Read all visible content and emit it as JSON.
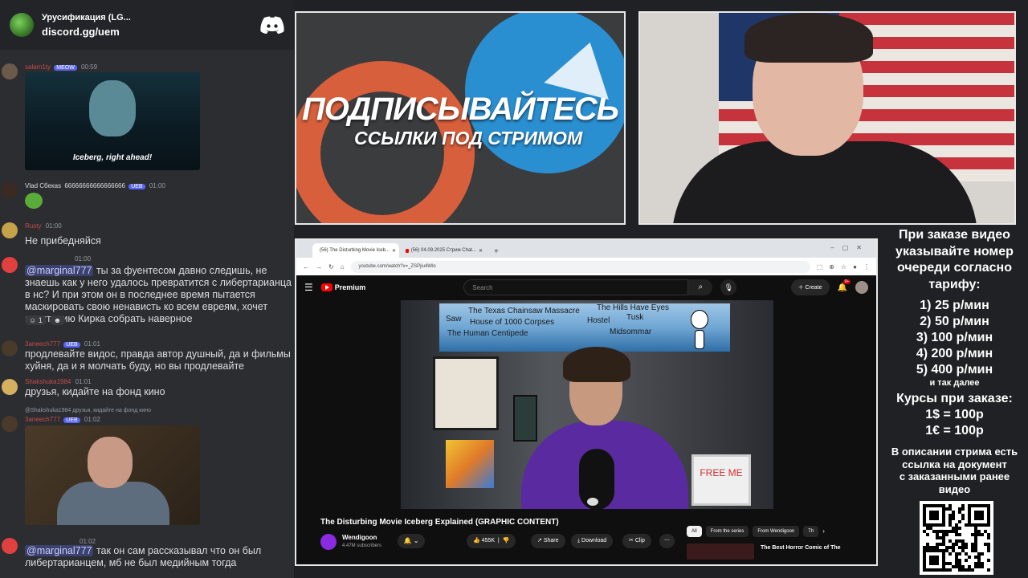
{
  "discord": {
    "server_name": "Урусификация (LG...",
    "invite": "discord.gg/uem",
    "messages": [
      {
        "user": "salam1ty",
        "badge": "MEOW",
        "time": "00:59",
        "gif_caption": "Iceberg, right ahead!"
      },
      {
        "user": "Vlad Сбекаs",
        "text_inline": "66666666666666666",
        "badge": "UEB",
        "time": "01:00"
      },
      {
        "user": "Rusty",
        "time": "01:00",
        "text": "Не прибедняйся"
      },
      {
        "text_mention": "@marginal777",
        "text": " ты за фуентесом давно следишь, не знаешь как у него удалось превратится с либертарианца в нс? И при этом он в последнее время пытается маскировать свою ненависть ко всем евреям, хочет аудиторию Кирка собрать наверное",
        "time": "01:00",
        "reaction_count": "1"
      },
      {
        "user": "3aneech777",
        "badge": "UEB",
        "time": "01:01",
        "text": "продлевайте видос, правда автор душный, да и фильмы хуйня, да и я молчать буду, но вы продлевайте"
      },
      {
        "user": "Shakshuka1984",
        "time": "01:01",
        "text": "друзья, кидайте на фонд кино"
      },
      {
        "reply_to": "@Shakshuka1984 друзья, кидайте на фонд кино",
        "user": "3aneech777",
        "badge": "UEB",
        "time": "01:02"
      },
      {
        "text_mention": "@marginal777",
        "text": " так он сам рассказывал что он был либертарианцем, мб не был медийным тогда",
        "time": "01:02"
      }
    ]
  },
  "promo": {
    "title": "ПОДПИСЫВАЙТЕСЬ",
    "subtitle": "ССЫЛКИ ПОД СТРИМОМ"
  },
  "browser": {
    "tabs": [
      {
        "label": "(56) The Disturbing Movie Iceb..."
      },
      {
        "label": "(56) 04.09.2025 Стрим Chat..."
      }
    ],
    "url": "youtube.com/watch?v=_ZSPjiu4Wlo"
  },
  "youtube": {
    "logo": "Premium",
    "search_placeholder": "Search",
    "create_label": "Create",
    "notification_count": "9+",
    "iceberg_labels": {
      "saw": "Saw",
      "tcm": "The Texas Chainsaw Massacre",
      "hills": "The Hills Have Eyes",
      "tusk": "Tusk",
      "house": "House of 1000 Corpses",
      "hostel": "Hostel",
      "centipede": "The Human Centipede",
      "midsommar": "Midsommar"
    },
    "free_me": "FREE ME",
    "video_title": "The Disturbing Movie Iceberg Explained (GRAPHIC CONTENT)",
    "channel_name": "Wendigoon",
    "subscribers": "4.47M subscribers",
    "likes": "455K",
    "share_label": "Share",
    "download_label": "Download",
    "clip_label": "Clip",
    "chips": [
      "All",
      "From the series",
      "From Wendigoon",
      "Th"
    ],
    "rec_title": "The Best Horror Comic of The"
  },
  "info": {
    "order_text": [
      "При заказе видео",
      "указывайте номер",
      "очереди согласно",
      "тарифу:"
    ],
    "tariffs": [
      "1) 25 р/мин",
      "2) 50 р/мин",
      "3) 100 р/мин",
      "4) 200 р/мин",
      "5) 400 р/мин"
    ],
    "etc": "и так далее",
    "rates_title": "Курсы при заказе:",
    "rates": [
      "1$ = 100р",
      "1€ = 100р"
    ],
    "description_note": [
      "В описании стрима есть",
      "ссылка на документ",
      "с заказанными ранее",
      "видео"
    ]
  },
  "colors": {
    "discord_bg": "#2b2d31",
    "youtube_bg": "#0f0f0f",
    "accent_red": "#ff0000",
    "telegram_blue": "#2a8fd1"
  }
}
